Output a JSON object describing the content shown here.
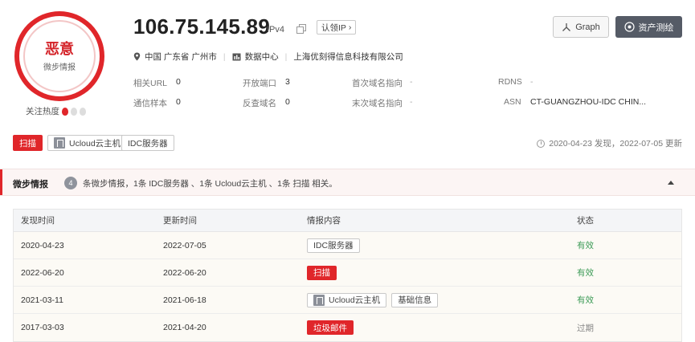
{
  "verdict": {
    "title": "恶意",
    "subtitle": "微步情报",
    "heat_label": "关注热度"
  },
  "header": {
    "ip": "106.75.145.89",
    "ip_version": "IPv4",
    "claim_label": "认领IP",
    "graph_label": "Graph",
    "asset_label": "资产测绘"
  },
  "location": {
    "region": "中国 广东省 广州市",
    "type": "数据中心",
    "org": "上海优刻得信息科技有限公司"
  },
  "stats": {
    "related_url_label": "相关URL",
    "related_url": "0",
    "open_ports_label": "开放端口",
    "open_ports": "3",
    "first_domain_label": "首次域名指向",
    "first_domain": "-",
    "rdns_label": "RDNS",
    "rdns": "-",
    "comm_samples_label": "通信样本",
    "comm_samples": "0",
    "reverse_domain_label": "反查域名",
    "reverse_domain": "0",
    "last_domain_label": "末次域名指向",
    "last_domain": "-",
    "asn_label": "ASN",
    "asn": "CT-GUANGZHOU-IDC CHIN..."
  },
  "tags": {
    "scan": "扫描",
    "ucloud": "Ucloud云主机",
    "idc": "IDC服务器"
  },
  "dates": "2020-04-23 发现，2022-07-05 更新",
  "section": {
    "name": "微步情报",
    "count": "4",
    "summary": "条微步情报，1条 IDC服务器 、1条 Ucloud云主机 、1条 扫描 相关。"
  },
  "table": {
    "headers": {
      "found": "发现时间",
      "updated": "更新时间",
      "content": "情报内容",
      "status": "状态"
    },
    "rows": [
      {
        "found": "2020-04-23",
        "updated": "2022-07-05",
        "tag1": "IDC服务器",
        "status": "有效"
      },
      {
        "found": "2022-06-20",
        "updated": "2022-06-20",
        "tag1": "扫描",
        "status": "有效"
      },
      {
        "found": "2021-03-11",
        "updated": "2021-06-18",
        "tag1": "Ucloud云主机",
        "tag2": "基础信息",
        "status": "有效"
      },
      {
        "found": "2017-03-03",
        "updated": "2021-04-20",
        "tag1": "垃圾邮件",
        "status": "过期"
      }
    ]
  },
  "colors": {
    "malicious": "#e0262a",
    "valid": "#3d9b57",
    "expired": "#888888"
  }
}
